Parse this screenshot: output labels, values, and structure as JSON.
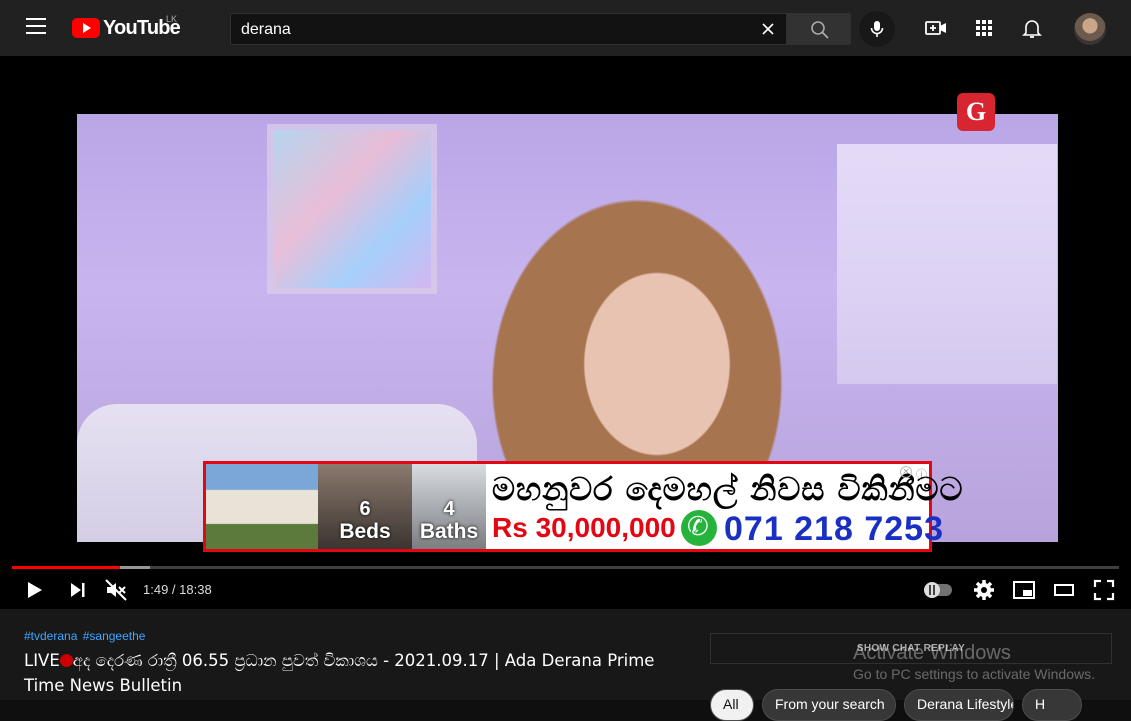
{
  "header": {
    "logo_text": "YouTube",
    "country_code": "LK",
    "search_value": "derana",
    "icons": [
      "menu-icon",
      "search-icon",
      "clear-icon",
      "mic-icon",
      "create-video-icon",
      "apps-icon",
      "notifications-icon",
      "avatar"
    ]
  },
  "ad": {
    "beds_count": "6",
    "beds_label": "Beds",
    "baths_count": "4",
    "baths_label": "Baths",
    "headline": "මහනුවර දෙමහල් නිවස විකිනීමට",
    "price": "Rs 30,000,000",
    "phone": "071 218 7253",
    "brand_color": "#e30613"
  },
  "player": {
    "channel_logo": "G",
    "time_current": "1:49",
    "time_total": "18:38",
    "time_display": "1:49 / 18:38",
    "progress_played_fraction": 0.098,
    "progress_loaded_fraction": 0.125,
    "muted": true,
    "accent_color": "#ff0000"
  },
  "video": {
    "hashtags": [
      "#tvderana",
      "#sangeethe"
    ],
    "title_prefix": "LIVE",
    "title_rest": "අද දෙරණ රාත්‍රී 06.55 ප්‍රධාන පුවත් විකාශය - 2021.09.17 | Ada Derana Prime Time News Bulletin"
  },
  "chat": {
    "replay_label": "SHOW CHAT REPLAY"
  },
  "watermark": {
    "title": "Activate Windows",
    "subtitle": "Go to PC settings to activate Windows."
  },
  "chips": [
    {
      "label": "All",
      "active": true
    },
    {
      "label": "From your search",
      "active": false
    },
    {
      "label": "Derana Lifestyle",
      "active": false
    },
    {
      "label": "H",
      "active": false
    }
  ]
}
